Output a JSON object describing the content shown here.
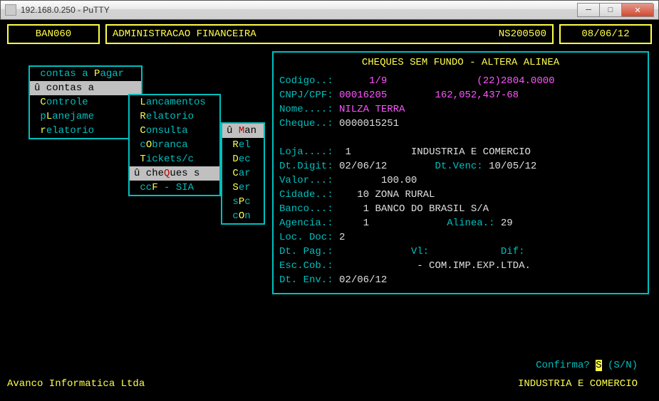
{
  "window": {
    "title": "192.168.0.250 - PuTTY"
  },
  "header": {
    "code": "BAN060",
    "title": "ADMINISTRACAO FINANCEIRA",
    "user": "NS200500",
    "date": "08/06/12"
  },
  "menu1": {
    "items": [
      {
        "pre": " ",
        "label": "contas a ",
        "hk": "P",
        "post": "agar   "
      },
      {
        "pre": "û",
        "label": " contas a ",
        "hk": "",
        "post": ""
      },
      {
        "pre": " ",
        "label": "",
        "hk": "C",
        "post": "ontrole       "
      },
      {
        "pre": " ",
        "label": "p",
        "hk": "L",
        "post": "anejame"
      },
      {
        "pre": " ",
        "label": "",
        "hk": "r",
        "post": "elatorio"
      }
    ],
    "selected": 1
  },
  "menu2": {
    "items": [
      {
        "pre": " ",
        "label": "",
        "hk": "L",
        "post": "ancamentos"
      },
      {
        "pre": " ",
        "label": "",
        "hk": "R",
        "post": "elatorio  "
      },
      {
        "pre": " ",
        "label": "",
        "hk": "C",
        "post": "onsulta   "
      },
      {
        "pre": " ",
        "label": "c",
        "hk": "O",
        "post": "branca   "
      },
      {
        "pre": " ",
        "label": "",
        "hk": "T",
        "post": "ickets/c"
      },
      {
        "pre": "û",
        "label": " che",
        "hk": "Q",
        "post": "ues s"
      },
      {
        "pre": " ",
        "label": "cc",
        "hk": "F",
        "post": " - SIA "
      }
    ],
    "selected": 5
  },
  "menu3": {
    "items": [
      {
        "pre": "û",
        "label": " ",
        "hk": "M",
        "post": "an"
      },
      {
        "pre": " ",
        "label": "",
        "hk": "R",
        "post": "el"
      },
      {
        "pre": " ",
        "label": "",
        "hk": "D",
        "post": "ec"
      },
      {
        "pre": " ",
        "label": "",
        "hk": "C",
        "post": "ar"
      },
      {
        "pre": " ",
        "label": "",
        "hk": "S",
        "post": "er"
      },
      {
        "pre": " ",
        "label": "s",
        "hk": "P",
        "post": "c"
      },
      {
        "pre": " ",
        "label": "c",
        "hk": "O",
        "post": "n"
      }
    ],
    "selected": 0
  },
  "detail": {
    "title": "CHEQUES SEM FUNDO - ALTERA ALINEA",
    "codigo_lbl": "Codigo..:",
    "codigo": "1/9",
    "codigo_ext_p1": "(22)",
    "codigo_ext_p2": "2804.0000",
    "cnpj_lbl": "CNPJ/CPF:",
    "cnpj": "00016205",
    "cnpj2": "162,052,437-68",
    "nome_lbl": "Nome....:",
    "nome": "NILZA TERRA",
    "cheque_lbl": "Cheque..:",
    "cheque": "0000015251",
    "loja_lbl": "Loja....:",
    "loja": "1",
    "loja_desc": "INDUSTRIA E COMERCIO",
    "dtdigit_lbl": "Dt.Digit:",
    "dtdigit": "02/06/12",
    "dtvenc_lbl": "Dt.Venc:",
    "dtvenc": "10/05/12",
    "valor_lbl": "Valor...:",
    "valor": "100.00",
    "cidade_lbl": "Cidade..:",
    "cidade": "10 ZONA RURAL",
    "banco_lbl": "Banco...:",
    "banco": "1 BANCO DO BRASIL S/A",
    "agencia_lbl": "Agencia.:",
    "agencia": "1",
    "alinea_lbl": "Alinea.:",
    "alinea": "29",
    "locdoc_lbl": "Loc. Doc:",
    "locdoc": "2",
    "dtpag_lbl": "Dt. Pag.:",
    "vl_lbl": "Vl:",
    "dif_lbl": "Dif:",
    "esccob_lbl": "Esc.Cob.:",
    "esccob": "- COM.IMP.EXP.LTDA.",
    "dtenv_lbl": "Dt. Env.:",
    "dtenv": "02/06/12"
  },
  "confirm": {
    "label": "Confirma?",
    "value": "S",
    "hint": "(S/N)"
  },
  "footer": {
    "left": "Avanco Informatica Ltda",
    "right": "INDUSTRIA E COMERCIO"
  }
}
